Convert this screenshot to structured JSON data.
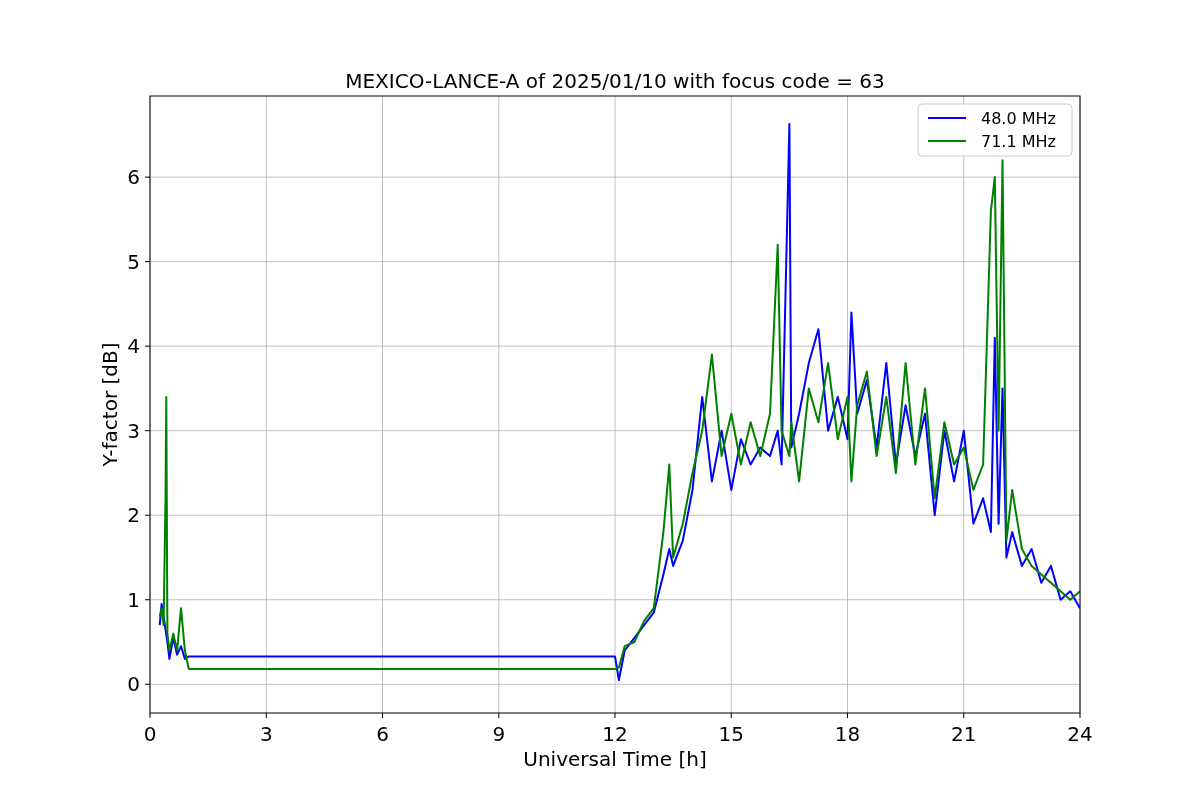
{
  "figure": {
    "chart_data": {
      "type": "line",
      "title": "MEXICO-LANCE-A of 2025/01/10 with focus code = 63",
      "xlabel": "Universal Time [h]",
      "ylabel": "Y-factor [dB]",
      "x": [
        0.25,
        0.3,
        0.35,
        0.4,
        0.42,
        0.45,
        0.5,
        0.6,
        0.7,
        0.8,
        0.9,
        1.0,
        12.0,
        12.1,
        12.25,
        12.5,
        12.75,
        13.0,
        13.25,
        13.4,
        13.5,
        13.75,
        14.0,
        14.25,
        14.5,
        14.75,
        15.0,
        15.25,
        15.5,
        15.75,
        16.0,
        16.2,
        16.3,
        16.5,
        16.55,
        16.75,
        17.0,
        17.25,
        17.5,
        17.75,
        18.0,
        18.1,
        18.25,
        18.5,
        18.75,
        19.0,
        19.25,
        19.5,
        19.75,
        20.0,
        20.25,
        20.5,
        20.75,
        21.0,
        21.25,
        21.5,
        21.7,
        21.8,
        21.9,
        22.0,
        22.1,
        22.25,
        22.5,
        22.75,
        23.0,
        23.25,
        23.5,
        23.75,
        24.0
      ],
      "series": [
        {
          "name": "48.0 MHz",
          "color": "#0000ff",
          "values": [
            0.7,
            0.95,
            0.8,
            null,
            null,
            0.5,
            0.3,
            0.55,
            0.35,
            0.45,
            0.3,
            0.33,
            0.33,
            0.05,
            0.4,
            0.55,
            0.7,
            0.85,
            1.3,
            1.6,
            1.4,
            1.7,
            2.3,
            3.4,
            2.4,
            3.0,
            2.3,
            2.9,
            2.6,
            2.8,
            2.7,
            3.0,
            2.6,
            6.63,
            2.8,
            3.2,
            3.8,
            4.2,
            3.0,
            3.4,
            2.9,
            4.4,
            3.2,
            3.6,
            2.8,
            3.8,
            2.6,
            3.3,
            2.7,
            3.2,
            2.0,
            3.0,
            2.4,
            3.0,
            1.9,
            2.2,
            1.8,
            4.1,
            1.9,
            3.5,
            1.5,
            1.8,
            1.4,
            1.6,
            1.2,
            1.4,
            1.0,
            1.1,
            0.9
          ]
        },
        {
          "name": "71.1 MHz",
          "color": "#008000",
          "values": [
            0.8,
            0.9,
            0.7,
            2.2,
            3.4,
            0.6,
            0.4,
            0.6,
            0.4,
            0.9,
            0.4,
            0.18,
            0.18,
            0.2,
            0.45,
            0.5,
            0.75,
            0.9,
            1.8,
            2.6,
            1.5,
            1.9,
            2.5,
            3.0,
            3.9,
            2.7,
            3.2,
            2.6,
            3.1,
            2.7,
            3.2,
            5.2,
            3.0,
            2.7,
            3.1,
            2.4,
            3.5,
            3.1,
            3.8,
            2.9,
            3.4,
            2.4,
            3.3,
            3.7,
            2.7,
            3.4,
            2.5,
            3.8,
            2.6,
            3.5,
            2.2,
            3.1,
            2.6,
            2.8,
            2.3,
            2.6,
            5.6,
            6.0,
            3.0,
            6.2,
            1.7,
            2.3,
            1.6,
            1.4,
            1.3,
            1.2,
            1.1,
            1.0,
            1.1
          ]
        }
      ],
      "xlim": [
        0,
        24
      ],
      "ylim": [
        -0.34,
        6.96
      ],
      "xticks": [
        0,
        3,
        6,
        9,
        12,
        15,
        18,
        21,
        24
      ],
      "yticks": [
        0,
        1,
        2,
        3,
        4,
        5,
        6
      ],
      "grid": true,
      "legend": true
    }
  }
}
